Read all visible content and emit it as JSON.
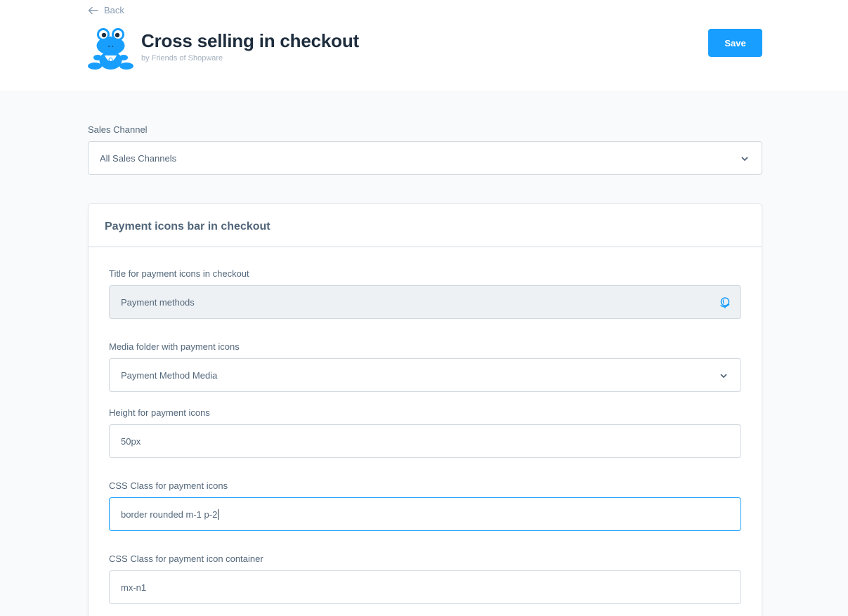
{
  "header": {
    "back_label": "Back",
    "title": "Cross selling in checkout",
    "author": "by Friends of Shopware",
    "save_label": "Save"
  },
  "sales_channel": {
    "label": "Sales Channel",
    "value": "All Sales Channels"
  },
  "card": {
    "title": "Payment icons bar in checkout",
    "fields": [
      {
        "label": "Title for payment icons in checkout",
        "value": "Payment methods",
        "icon": "globe-icon"
      },
      {
        "label": "Media folder with payment icons",
        "value": "Payment Method Media",
        "icon": "chevron-down-icon"
      },
      {
        "label": "Height for payment icons",
        "value": "50px"
      },
      {
        "label": "CSS Class for payment icons",
        "value": "border rounded m-1 p-2"
      },
      {
        "label": "CSS Class for payment icon container",
        "value": "mx-n1"
      }
    ]
  },
  "colors": {
    "accent": "#189eff",
    "text": "#52667a",
    "title": "#1e2d3d",
    "border": "#d1d9e0",
    "page_bg": "#f9fafb"
  }
}
